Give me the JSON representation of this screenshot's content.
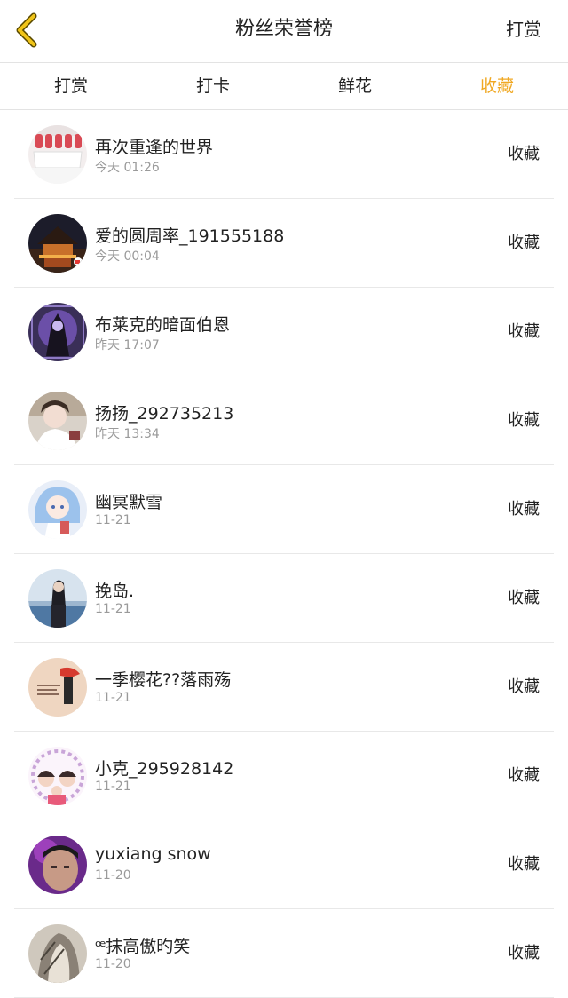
{
  "header": {
    "title": "粉丝荣誉榜",
    "action": "打赏",
    "back_icon": "chevron-left-icon",
    "accent_color": "#f0a823"
  },
  "tabs": [
    {
      "label": "打赏",
      "active": false
    },
    {
      "label": "打卡",
      "active": false
    },
    {
      "label": "鲜花",
      "active": false
    },
    {
      "label": "收藏",
      "active": true
    }
  ],
  "fans": [
    {
      "name": "再次重逢的世界",
      "time": "今天 01:26",
      "action": "收藏"
    },
    {
      "name": "爱的圆周率_191555188",
      "time": "今天 00:04",
      "action": "收藏"
    },
    {
      "name": "布莱克的暗面伯恩",
      "time": "昨天 17:07",
      "action": "收藏"
    },
    {
      "name": "扬扬_292735213",
      "time": "昨天 13:34",
      "action": "收藏"
    },
    {
      "name": "幽冥默雪",
      "time": "11-21",
      "action": "收藏"
    },
    {
      "name": "挽岛.",
      "time": "11-21",
      "action": "收藏"
    },
    {
      "name": "一季樱花??落雨殇",
      "time": "11-21",
      "action": "收藏"
    },
    {
      "name": "小克_295928142",
      "time": "11-21",
      "action": "收藏"
    },
    {
      "name": "yuxiang snow",
      "time": "11-20",
      "action": "收藏"
    },
    {
      "name": "ꟹ抹高傲旳笑",
      "time": "11-20",
      "action": "收藏"
    }
  ]
}
